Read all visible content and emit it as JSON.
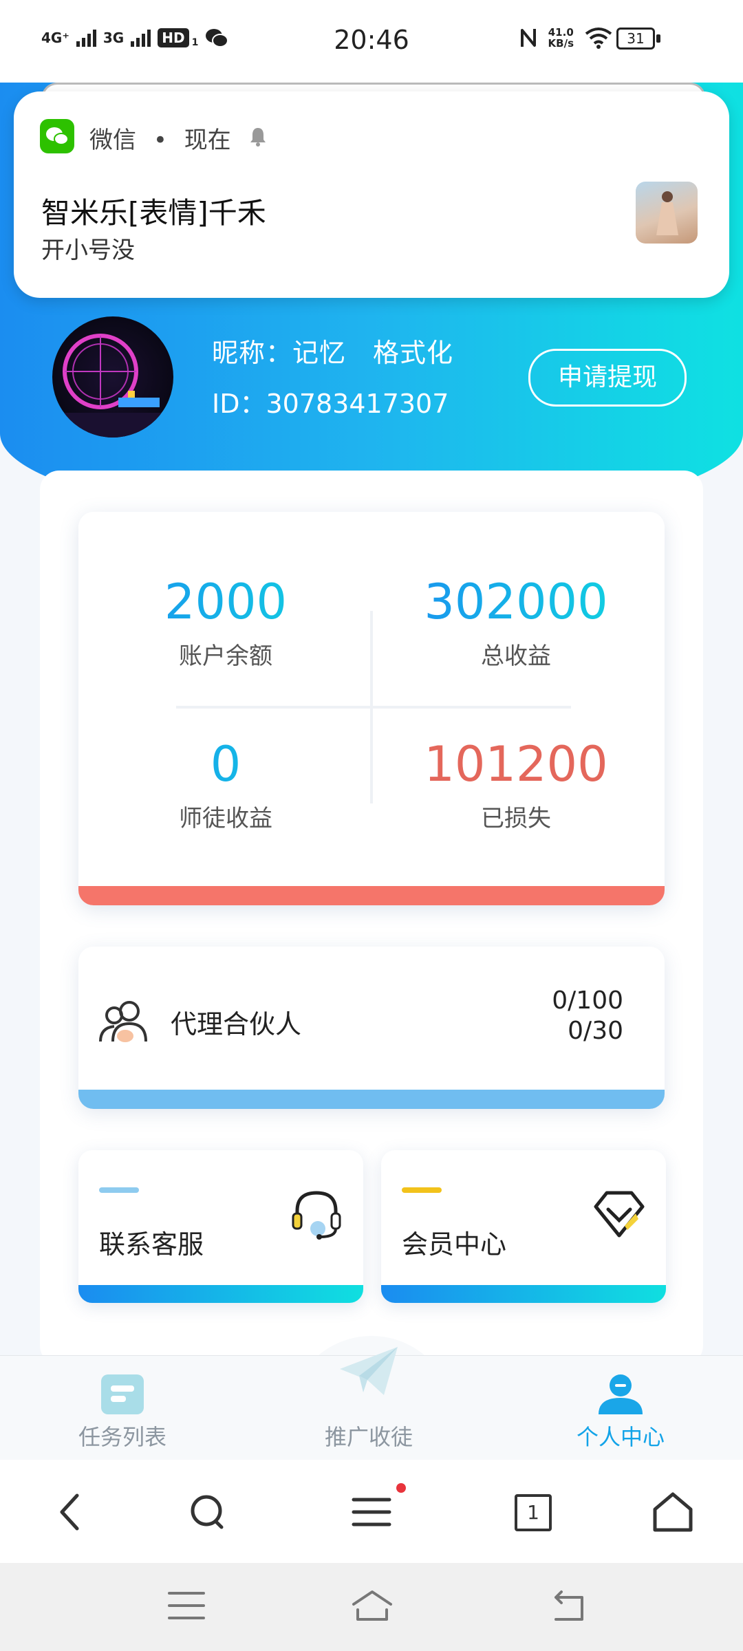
{
  "status_bar": {
    "network_1": "4G⁺",
    "network_2": "3G",
    "hd_label": "HD",
    "hd_sub": "1",
    "time": "20:46",
    "speed_value": "41.0",
    "speed_unit": "KB/s",
    "battery": "31"
  },
  "notification": {
    "app_name": "微信",
    "separator": "•",
    "when": "现在",
    "title": "智米乐[表情]千禾",
    "body": "开小号没"
  },
  "profile": {
    "nickname_line": "昵称：记忆　格式化",
    "id_line": "ID：30783417307",
    "withdraw_label": "申请提现"
  },
  "stats": {
    "balance_value": "2000",
    "balance_label": "账户余额",
    "total_value": "302000",
    "total_label": "总收益",
    "mentor_value": "0",
    "mentor_label": "师徒收益",
    "lost_value": "101200",
    "lost_label": "已损失"
  },
  "partner": {
    "label": "代理合伙人",
    "count_1": "0/100",
    "count_2": "0/30"
  },
  "cards": {
    "service_label": "联系客服",
    "member_label": "会员中心"
  },
  "tabs": {
    "task_label": "任务列表",
    "promote_label": "推广收徒",
    "me_label": "个人中心"
  },
  "browser": {
    "tab_count": "1"
  },
  "colors": {
    "accent_blue": "#1a8cf0",
    "accent_cyan": "#10dfe0",
    "loss_red": "#e4675b",
    "card_red_bar": "#f5756a",
    "partner_bar": "#70bdf0",
    "active_tab": "#12a3e8",
    "wechat_green": "#2dc100"
  },
  "icons": {
    "partner": "people-icon",
    "service": "headset-icon",
    "member": "diamond-icon",
    "tab_task": "task-list-icon",
    "tab_promote": "paper-plane-icon",
    "tab_me": "person-icon"
  }
}
